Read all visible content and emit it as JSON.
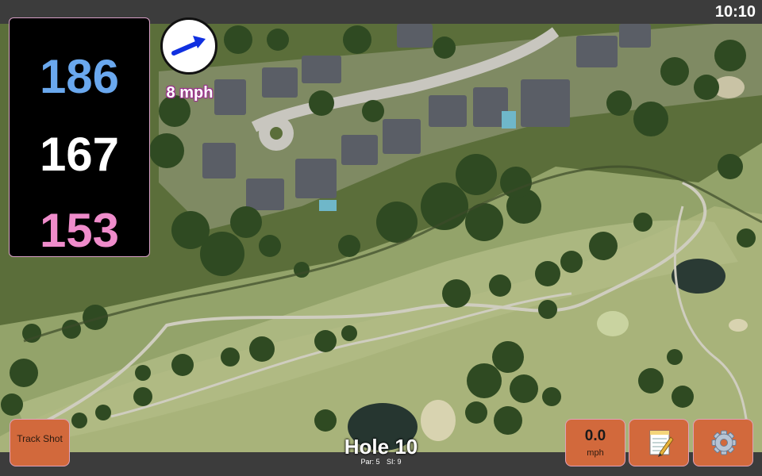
{
  "status": {
    "time": "10:10"
  },
  "distances": {
    "back": "186",
    "middle": "167",
    "front": "153",
    "colors": {
      "back": "#6aa8ee",
      "middle": "#ffffff",
      "front": "#ef8ccb"
    }
  },
  "wind": {
    "icon": "wind-direction-arrow-icon",
    "speed_label": "8 mph",
    "arrow_color": "#1030e0"
  },
  "hole": {
    "title": "Hole 10",
    "par_label": "Par: 5",
    "si_label": "SI: 9"
  },
  "buttons": {
    "track_shot": "Track Shot",
    "speed_value": "0.0",
    "speed_unit": "mph",
    "notes_icon": "notepad-icon",
    "settings_icon": "gear-icon"
  },
  "colors": {
    "button": "#d2693c",
    "bar": "#3c3c3c"
  }
}
